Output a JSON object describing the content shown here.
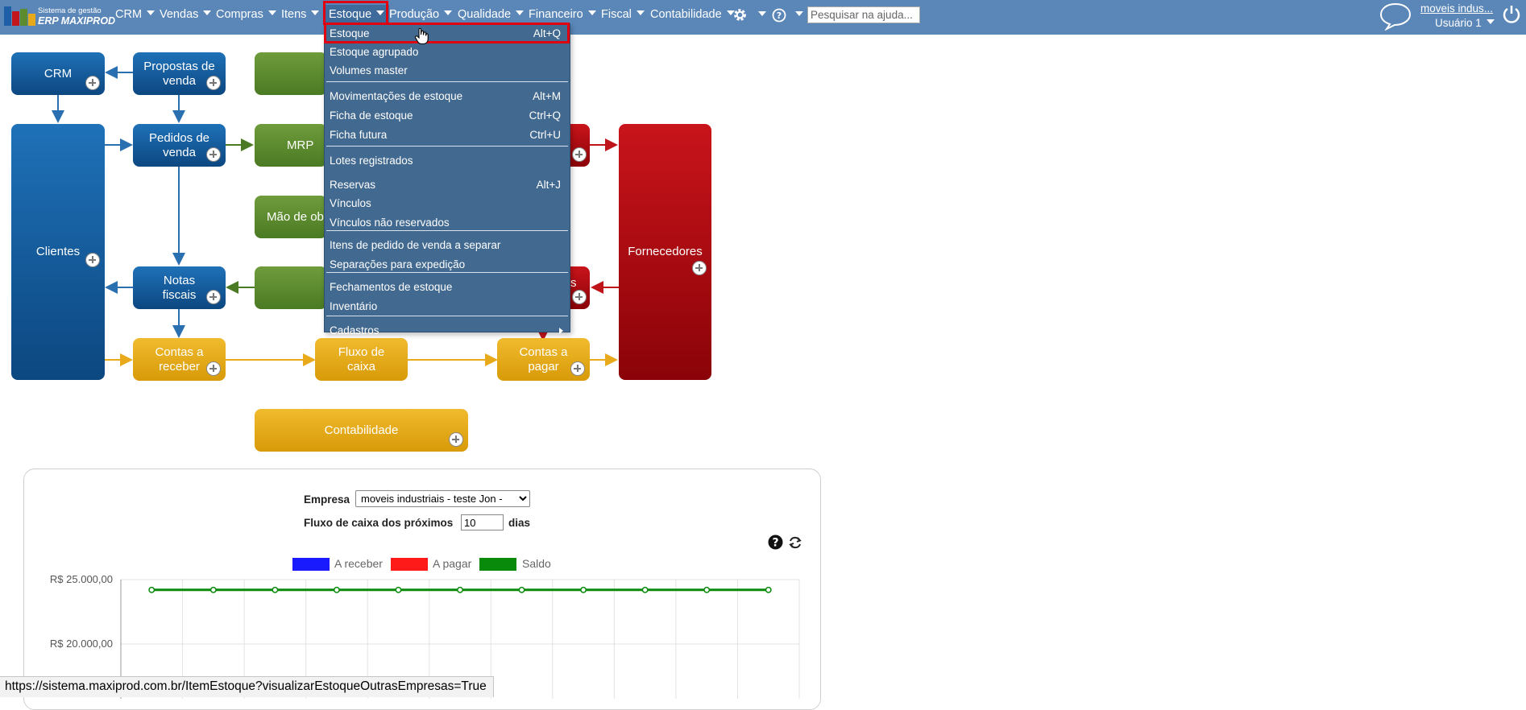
{
  "brand": {
    "line1": "Sistema de gestão",
    "line2": "ERP MAXIPROD"
  },
  "nav": {
    "items": [
      "CRM",
      "Vendas",
      "Compras",
      "Itens",
      "Estoque",
      "Produção",
      "Qualidade",
      "Financeiro",
      "Fiscal",
      "Contabilidade"
    ],
    "search_placeholder": "Pesquisar na ajuda...",
    "company": "moveis indus...",
    "user": "Usuário 1"
  },
  "menu": {
    "items": [
      {
        "label": "Estoque",
        "shortcut": "Alt+Q"
      },
      {
        "label": "Estoque agrupado",
        "shortcut": ""
      },
      {
        "label": "Volumes master",
        "shortcut": ""
      },
      {
        "label": "Movimentações de estoque",
        "shortcut": "Alt+M"
      },
      {
        "label": "Ficha de estoque",
        "shortcut": "Ctrl+Q"
      },
      {
        "label": "Ficha futura",
        "shortcut": "Ctrl+U"
      },
      {
        "label": "Lotes registrados",
        "shortcut": ""
      },
      {
        "label": "Reservas",
        "shortcut": "Alt+J"
      },
      {
        "label": "Vínculos",
        "shortcut": ""
      },
      {
        "label": "Vínculos não reservados",
        "shortcut": ""
      },
      {
        "label": "Itens de pedido de venda a separar",
        "shortcut": ""
      },
      {
        "label": "Separações para expedição",
        "shortcut": ""
      },
      {
        "label": "Fechamentos de estoque",
        "shortcut": ""
      },
      {
        "label": "Inventário",
        "shortcut": ""
      },
      {
        "label": "Cadastros",
        "shortcut": ""
      }
    ]
  },
  "diagram": {
    "crm": "CRM",
    "propostas": "Propostas de venda",
    "clientes": "Clientes",
    "pedidos": "Pedidos de venda",
    "mrp": "MRP",
    "mao_de_obra": "Mão de obr",
    "notas": "Notas fiscais",
    "notas_right": "s",
    "fornecedores": "Fornecedores",
    "contas_receber": "Contas a receber",
    "fluxo_caixa": "Fluxo de caixa",
    "contas_pagar": "Contas a pagar",
    "contabilidade": "Contabilidade"
  },
  "panel": {
    "empresa_label": "Empresa",
    "empresa_value": "moveis industriais - teste Jon -",
    "fluxo_label": "Fluxo de caixa dos próximos",
    "dias_value": "10",
    "dias_label": "dias"
  },
  "chart_data": {
    "type": "line",
    "legend": [
      "A receber",
      "A pagar",
      "Saldo"
    ],
    "colors": {
      "A receber": "#1a1aff",
      "A pagar": "#ff1a1a",
      "Saldo": "#0a8a0a"
    },
    "y_ticks": [
      "R$ 25.000,00",
      "R$ 20.000,00"
    ],
    "series": [
      {
        "name": "Saldo",
        "values": [
          24200,
          24200,
          24200,
          24200,
          24200,
          24200,
          24200,
          24200,
          24200,
          24200,
          24200
        ]
      }
    ],
    "ylim": [
      20000,
      25000
    ],
    "legend_position": "top"
  },
  "statusbar": "https://sistema.maxiprod.com.br/ItemEstoque?visualizarEstoqueOutrasEmpresas=True"
}
